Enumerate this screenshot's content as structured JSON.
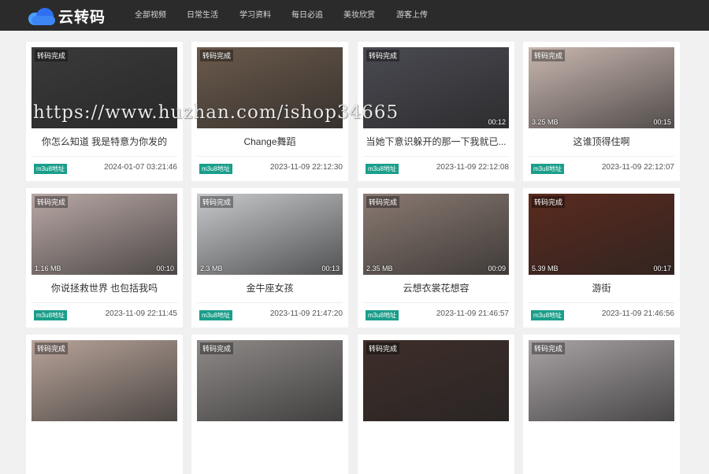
{
  "header": {
    "logo_text": "云转码",
    "nav": [
      "全部视频",
      "日常生活",
      "学习资料",
      "每日必追",
      "美妆欣赏",
      "游客上传"
    ]
  },
  "status_badge": "转码完成",
  "m3u8_label": "m3u8地址",
  "watermark": "https://www.huzhan.com/ishop34665",
  "videos": [
    {
      "title": "你怎么知道 我是特意为你发的",
      "size": "",
      "duration": "",
      "date": "2024-01-07 03:21:46",
      "tone": "#3a3a3a"
    },
    {
      "title": "Change舞蹈",
      "size": "",
      "duration": "",
      "date": "2023-11-09 22:12:30",
      "tone": "#6b5a4c"
    },
    {
      "title": "当她下意识躲开的那一下我就已...",
      "size": "",
      "duration": "00:12",
      "date": "2023-11-09 22:12:08",
      "tone": "#4a4a52"
    },
    {
      "title": "这谁顶得住啊",
      "size": "3.25 MB",
      "duration": "00:15",
      "date": "2023-11-09 22:12:07",
      "tone": "#c9b7b0"
    },
    {
      "title": "你说拯救世界 也包括我吗",
      "size": "1.16 MB",
      "duration": "00:10",
      "date": "2023-11-09 22:11:45",
      "tone": "#b9a8a5"
    },
    {
      "title": "金牛座女孩",
      "size": "2.3 MB",
      "duration": "00:13",
      "date": "2023-11-09 21:47:20",
      "tone": "#c7c9cc"
    },
    {
      "title": "云想衣裳花想容",
      "size": "2.35 MB",
      "duration": "00:09",
      "date": "2023-11-09 21:46:57",
      "tone": "#8a7a72"
    },
    {
      "title": "游街",
      "size": "5.39 MB",
      "duration": "00:17",
      "date": "2023-11-09 21:46:56",
      "tone": "#5a2a1e"
    },
    {
      "title": "",
      "size": "",
      "duration": "",
      "date": "",
      "tone": "#b8a49a"
    },
    {
      "title": "",
      "size": "",
      "duration": "",
      "date": "",
      "tone": "#8e8a88"
    },
    {
      "title": "",
      "size": "",
      "duration": "",
      "date": "",
      "tone": "#3e2e2a"
    },
    {
      "title": "",
      "size": "",
      "duration": "",
      "date": "",
      "tone": "#a9a3a6"
    }
  ]
}
